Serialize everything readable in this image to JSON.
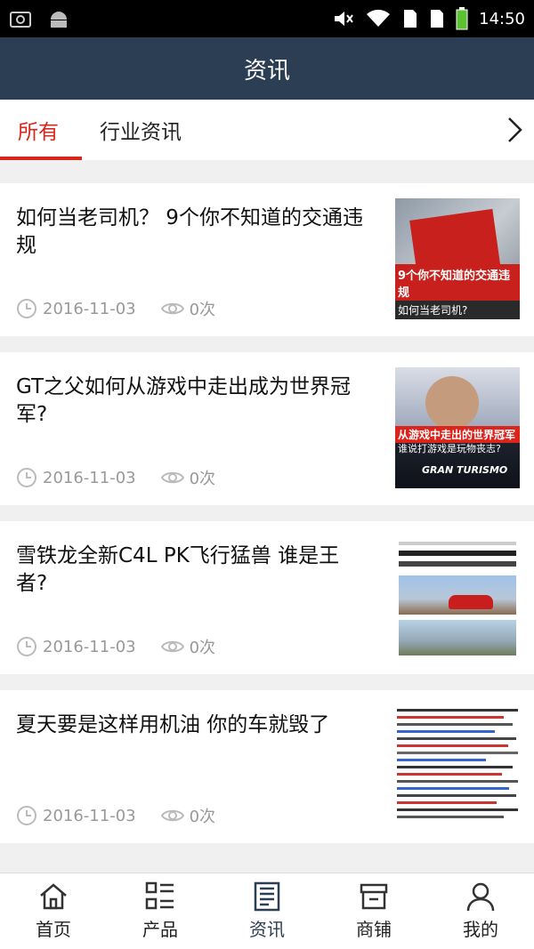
{
  "status_bar": {
    "time": "14:50",
    "icons": [
      "screenshot-icon",
      "android-icon",
      "mute-icon",
      "wifi-icon",
      "sim1-icon",
      "sim2-icon",
      "battery-icon"
    ]
  },
  "header": {
    "title": "资讯"
  },
  "tabs": [
    {
      "label": "所有",
      "active": true
    },
    {
      "label": "行业资讯",
      "active": false
    }
  ],
  "news": [
    {
      "title": "如何当老司机？ 9个你不知道的交通违规",
      "date": "2016-11-03",
      "views": "0次",
      "thumb_caption_main": "9个你不知道的交通违规",
      "thumb_caption_sub": "如何当老司机?"
    },
    {
      "title": "GT之父如何从游戏中走出成为世界冠军?",
      "date": "2016-11-03",
      "views": "0次",
      "thumb_caption_main": "从游戏中走出的世界冠军",
      "thumb_caption_sub": "谁说打游戏是玩物丧志?",
      "thumb_logo": "GRAN TURISMO"
    },
    {
      "title": "雪铁龙全新C4L PK飞行猛兽 谁是王者?",
      "date": "2016-11-03",
      "views": "0次"
    },
    {
      "title": "夏天要是这样用机油 你的车就毁了",
      "date": "2016-11-03",
      "views": "0次"
    }
  ],
  "bottom_nav": [
    {
      "label": "首页",
      "icon": "home-icon",
      "active": false
    },
    {
      "label": "产品",
      "icon": "grid-list-icon",
      "active": false
    },
    {
      "label": "资讯",
      "icon": "news-icon",
      "active": true
    },
    {
      "label": "商铺",
      "icon": "shop-icon",
      "active": false
    },
    {
      "label": "我的",
      "icon": "user-icon",
      "active": false
    }
  ],
  "colors": {
    "header_bg": "#2b3e54",
    "accent": "#d9251c",
    "meta": "#999999"
  }
}
